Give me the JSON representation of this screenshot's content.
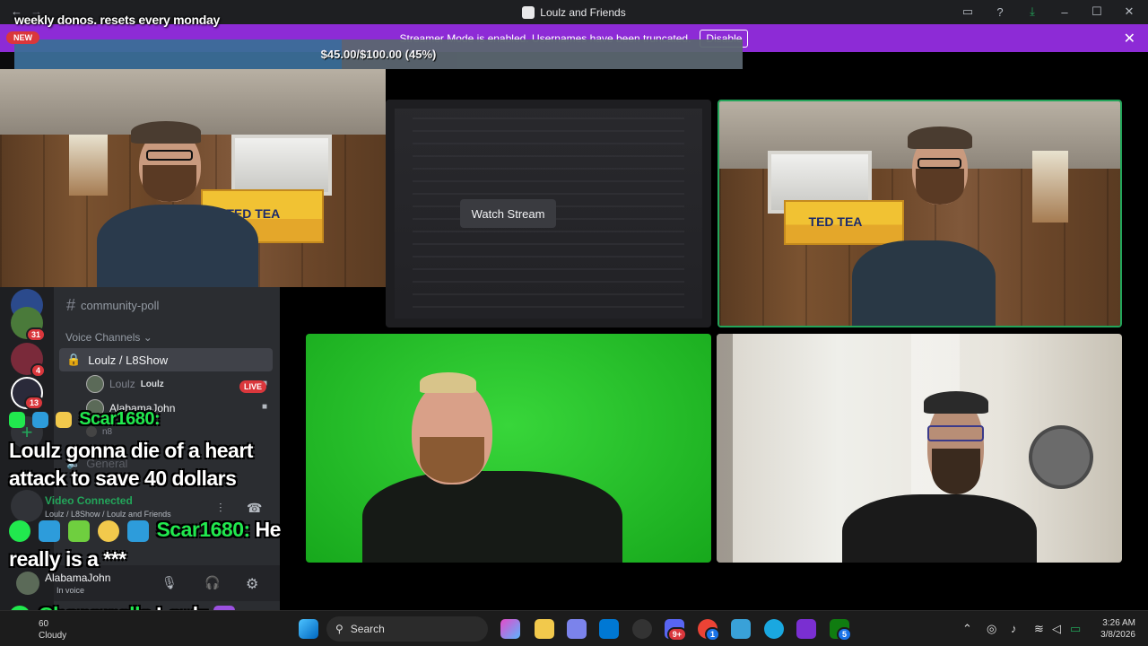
{
  "window": {
    "title": "Loulz and Friends"
  },
  "banner": {
    "text": "Streamer Mode is enabled. Usernames have been truncated.",
    "disable_label": "Disable",
    "close_icon": "close-icon"
  },
  "overlay": {
    "donos_text": "weekly donos. resets every monday",
    "new_badge": "NEW",
    "progress_text": "$45.00/$100.00 (45%)",
    "progress_fraction": 0.45
  },
  "sidebar": {
    "channels": [
      {
        "label": "community-poll"
      }
    ],
    "voice_header": "Voice Channels",
    "active_voice": "Loulz / L8Show",
    "voice_users": [
      {
        "name": "Loulz",
        "tag": "Loulz",
        "live": "LIVE"
      },
      {
        "name": "AlabamaJohn"
      },
      {
        "name": "n8"
      }
    ],
    "general_label": "General",
    "guild_badges": [
      "31",
      "4",
      "13"
    ],
    "vc_status": "Video Connected",
    "vc_sub": "Loulz / L8Show / Loulz and Friends",
    "user": {
      "name": "AlabamaJohn",
      "status": "In voice"
    }
  },
  "chat": {
    "partial_name": "Scar1680:",
    "line1": "Loulz gonna die of a heart",
    "line2": "attack to save 40 dollars",
    "msg_author": "Scar1680:",
    "msg_text_a": "He",
    "msg_text_b": "really is a ***",
    "bottom_author": "Chopsmells",
    "bottom_text": "Loulz"
  },
  "stage": {
    "watch_label": "Watch Stream"
  },
  "taskbar": {
    "weather_temp": "60",
    "weather_desc": "Cloudy",
    "search_label": "Search",
    "time": "3:26 AM",
    "date": "3/8/2026",
    "badges": [
      "9+",
      "1",
      "5"
    ]
  },
  "colors": {
    "accent_purple": "#8d2bd6",
    "speaking_green": "#23a55a",
    "live_red": "#da373c"
  }
}
